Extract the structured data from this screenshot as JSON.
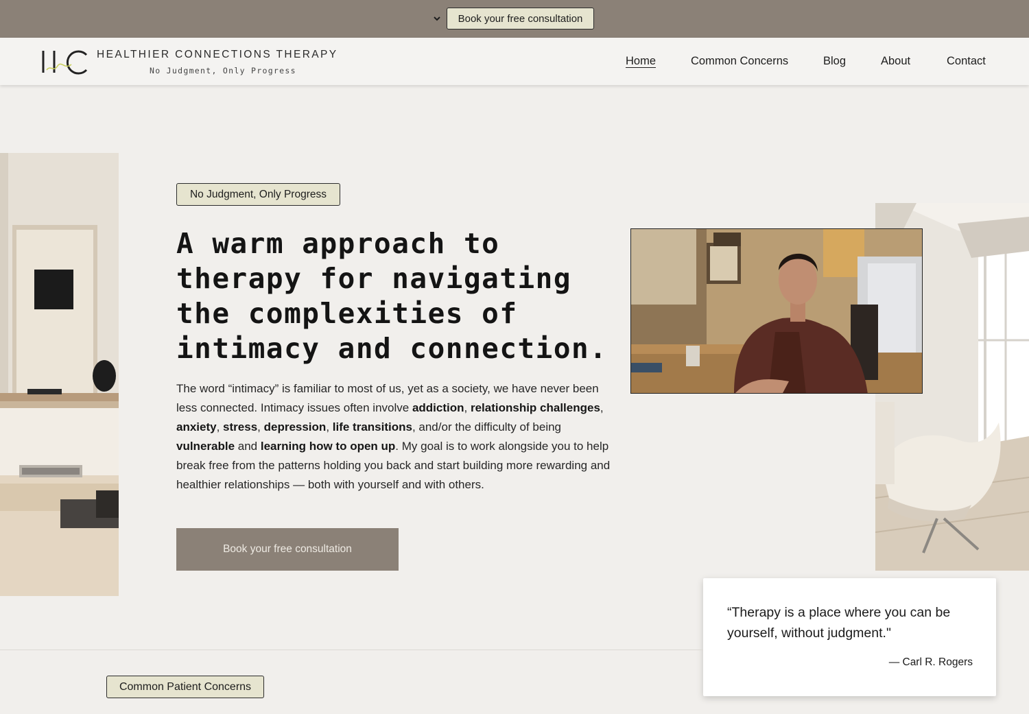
{
  "topbar": {
    "cta_label": "Book your free consultation"
  },
  "header": {
    "logo_letters": "HC",
    "brand_name": "HEALTHIER CONNECTIONS THERAPY",
    "brand_tagline": "No Judgment, Only Progress",
    "nav": [
      {
        "label": "Home",
        "active": true
      },
      {
        "label": "Common Concerns",
        "active": false
      },
      {
        "label": "Blog",
        "active": false
      },
      {
        "label": "About",
        "active": false
      },
      {
        "label": "Contact",
        "active": false
      }
    ]
  },
  "hero": {
    "pill": "No Judgment, Only Progress",
    "headline": "A warm approach to therapy for navigating the complexities of intimacy and connection.",
    "body": [
      {
        "t": "The word “intimacy” is familiar to most of us, yet as a society, we have never been less connected. Intimacy issues often involve ",
        "b": false
      },
      {
        "t": "addiction",
        "b": true
      },
      {
        "t": ", ",
        "b": false
      },
      {
        "t": "relationship challenges",
        "b": true
      },
      {
        "t": ", ",
        "b": false
      },
      {
        "t": "anxiety",
        "b": true
      },
      {
        "t": ", ",
        "b": false
      },
      {
        "t": "stress",
        "b": true
      },
      {
        "t": ", ",
        "b": false
      },
      {
        "t": "depression",
        "b": true
      },
      {
        "t": ", ",
        "b": false
      },
      {
        "t": "life transitions",
        "b": true
      },
      {
        "t": ", and/or the difficulty of being ",
        "b": false
      },
      {
        "t": "vulnerable",
        "b": true
      },
      {
        "t": " and ",
        "b": false
      },
      {
        "t": "learning how to open up",
        "b": true
      },
      {
        "t": ". My goal is to work alongside you to help break free from the patterns holding you back and start building more rewarding and healthier relationships — both with yourself and with others.",
        "b": false
      }
    ],
    "cta_label": "Book your free consultation"
  },
  "quote": {
    "text": "“Therapy is a place where you can be yourself, without judgment.\"",
    "author": "— Carl R. Rogers"
  },
  "section": {
    "pill": "Common Patient Concerns"
  },
  "colors": {
    "topbar_bg": "#8b8177",
    "pill_bg": "#e6e4cf",
    "page_bg": "#f1efec",
    "cta_bg": "#8b8177"
  },
  "icons": {
    "topbar_toggle": "chevron-down-icon"
  }
}
